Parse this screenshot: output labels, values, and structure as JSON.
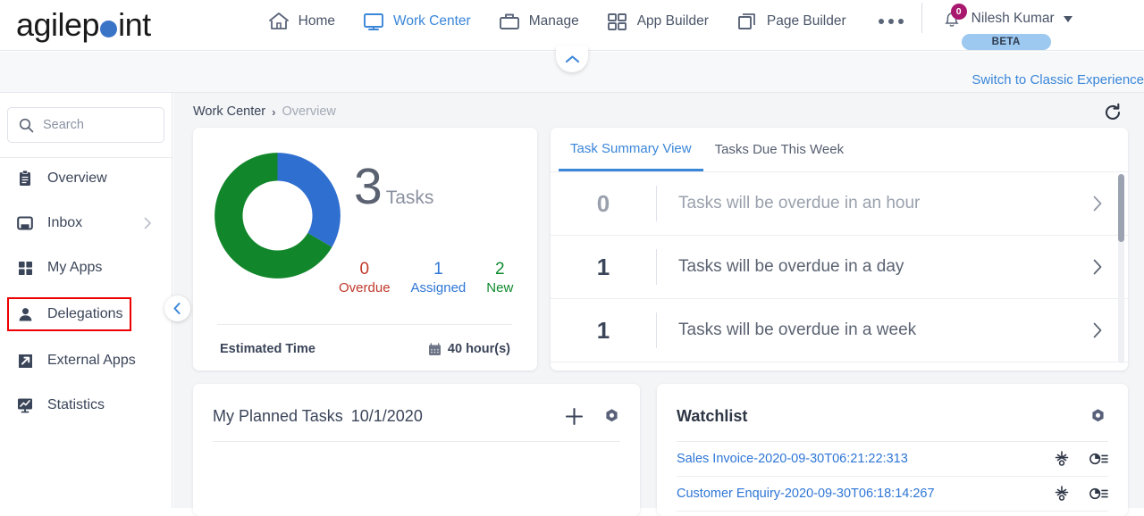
{
  "brand": {
    "name_part1": "agilep",
    "name_part2": "int",
    "dot_color": "#3a74c7"
  },
  "topnav": {
    "items": [
      {
        "label": "Home",
        "icon": "home-icon",
        "active": false
      },
      {
        "label": "Work Center",
        "icon": "monitor-icon",
        "active": true
      },
      {
        "label": "Manage",
        "icon": "briefcase-icon",
        "active": false
      },
      {
        "label": "App Builder",
        "icon": "grid-icon",
        "active": false
      },
      {
        "label": "Page Builder",
        "icon": "pages-icon",
        "active": false
      }
    ],
    "more_label": "•••",
    "notification_count": "0",
    "user_name": "Nilesh Kumar",
    "beta_label": "BETA"
  },
  "subbar": {
    "classic_link": "Switch to Classic Experience"
  },
  "sidebar": {
    "search_placeholder": "Search",
    "search_value": "",
    "items": [
      {
        "label": "Overview",
        "icon": "clipboard-icon",
        "highlighted": false,
        "has_chevron": false
      },
      {
        "label": "Inbox",
        "icon": "inbox-icon",
        "highlighted": false,
        "has_chevron": true
      },
      {
        "label": "My Apps",
        "icon": "apps-grid-icon",
        "highlighted": false,
        "has_chevron": false
      },
      {
        "label": "Delegations",
        "icon": "person-icon",
        "highlighted": true,
        "has_chevron": false
      },
      {
        "label": "External Apps",
        "icon": "external-link-icon",
        "highlighted": false,
        "has_chevron": false
      },
      {
        "label": "Statistics",
        "icon": "statistics-icon",
        "highlighted": false,
        "has_chevron": false
      }
    ],
    "highlight_color": "#ee0000"
  },
  "breadcrumb": {
    "root": "Work Center",
    "separator": "›",
    "current": "Overview"
  },
  "task_summary_card": {
    "total": "3",
    "total_label": "Tasks",
    "legend": [
      {
        "value": "0",
        "label": "Overdue",
        "color": "#c0392b"
      },
      {
        "value": "1",
        "label": "Assigned",
        "color": "#2e76d6"
      },
      {
        "value": "2",
        "label": "New",
        "color": "#0f8a2e"
      }
    ],
    "estimated_time_label": "Estimated Time",
    "estimated_time_value": "40 hour(s)"
  },
  "chart_data": {
    "type": "pie",
    "title": "Tasks",
    "categories": [
      "Assigned",
      "New"
    ],
    "values": [
      1,
      2
    ],
    "colors": [
      "#2f6fd0",
      "#12862b"
    ],
    "total": 3,
    "donut": true,
    "legend_position": "right",
    "annotations": [
      "0 Overdue",
      "1 Assigned",
      "2 New"
    ]
  },
  "summary_panel": {
    "tabs": [
      {
        "label": "Task Summary View",
        "active": true
      },
      {
        "label": "Tasks Due This Week",
        "active": false
      }
    ],
    "rows": [
      {
        "count": "0",
        "text": "Tasks will be overdue in an hour",
        "muted": true
      },
      {
        "count": "1",
        "text": "Tasks will be overdue in a day",
        "muted": false
      },
      {
        "count": "1",
        "text": "Tasks will be overdue in a week",
        "muted": false
      }
    ]
  },
  "planned_tasks": {
    "title": "My Planned Tasks",
    "date": "10/1/2020",
    "add_icon": "plus-icon",
    "settings_icon": "gear-icon"
  },
  "watchlist": {
    "title": "Watchlist",
    "settings_icon": "gear-icon",
    "rows": [
      {
        "name": "Sales Invoice-2020-09-30T06:21:22:313"
      },
      {
        "name": "Customer Enquiry-2020-09-30T06:18:14:267"
      }
    ],
    "row_icon_1": "process-icon",
    "row_icon_2": "history-icon"
  }
}
